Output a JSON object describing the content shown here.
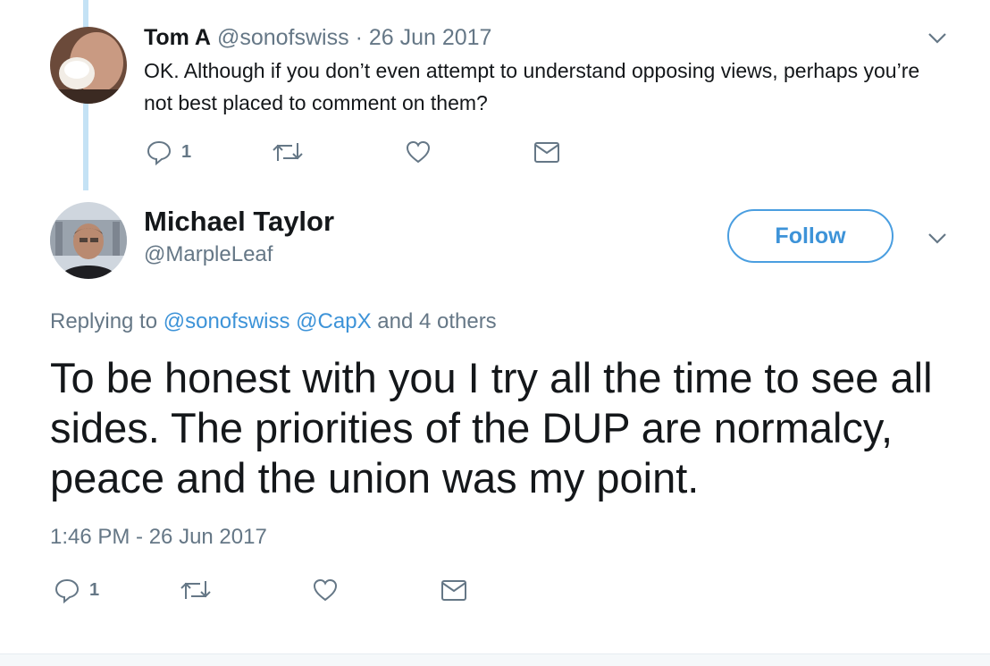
{
  "colors": {
    "accent": "#1da1f2",
    "muted": "#657786",
    "text": "#14171a",
    "thread": "#c4e2f5"
  },
  "parent_tweet": {
    "name": "Tom A",
    "handle": "@sonofswiss",
    "separator": "·",
    "date": "26 Jun 2017",
    "text": "OK. Although if you don’t even attempt to understand opposing views, perhaps you’re not best placed to comment on them?",
    "actions": {
      "reply_icon": "reply-icon",
      "reply_count": "1",
      "retweet_icon": "retweet-icon",
      "like_icon": "heart-icon",
      "dm_icon": "envelope-icon"
    }
  },
  "main_tweet": {
    "name": "Michael Taylor",
    "handle": "@MarpleLeaf",
    "follow_label": "Follow",
    "replying_prefix": "Replying to",
    "replying_mentions": [
      "@sonofswiss",
      "@CapX"
    ],
    "replying_suffix": "and 4 others",
    "text": "To be honest with you I try all the time to see all sides. The priorities of the DUP are normalcy, peace and the union was my point.",
    "timestamp": "1:46 PM - 26 Jun 2017",
    "actions": {
      "reply_icon": "reply-icon",
      "reply_count": "1",
      "retweet_icon": "retweet-icon",
      "like_icon": "heart-icon",
      "dm_icon": "envelope-icon"
    }
  }
}
